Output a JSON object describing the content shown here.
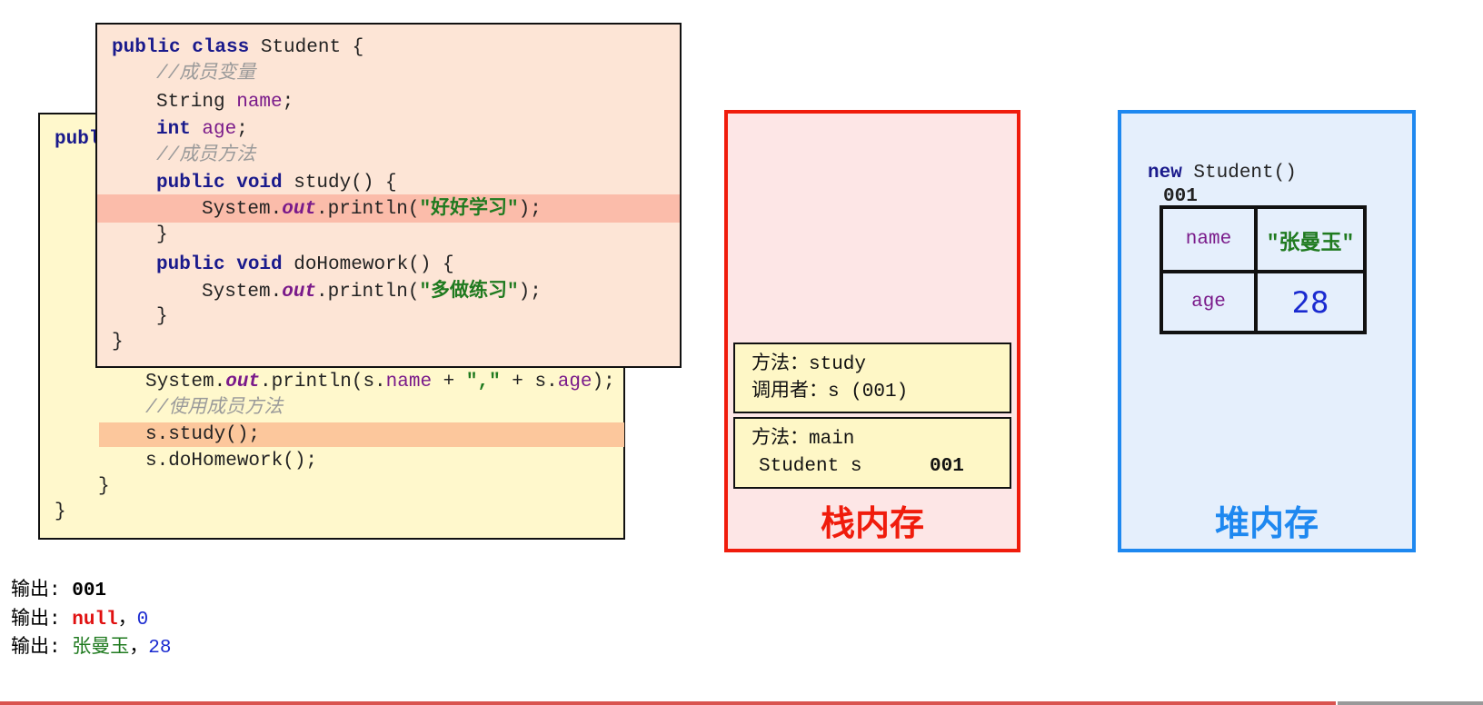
{
  "back_code": {
    "line_partial": "publ",
    "println_prefix": "System.",
    "out": "out",
    "println_mid": ".println(s.",
    "name": "name",
    "plus1": " + ",
    "comma_str": "\",\"",
    "plus2": " + s.",
    "age": "age",
    "end": ");",
    "comment": "//使用成员方法",
    "study_call": "s.study();",
    "homework_call": "s.doHomework();",
    "close_inner": "}",
    "close_outer": "}"
  },
  "front_code": {
    "kw_public_class": "public class",
    "class_name": " Student {",
    "comment_fields": "//成员变量",
    "string_type": "String ",
    "field_name": "name",
    "semi": ";",
    "int_type": "int",
    "field_age": "age",
    "comment_methods": "//成员方法",
    "kw_public_void": "public void",
    "study_sig": " study() {",
    "sys": "System.",
    "out": "out",
    "println": ".println(",
    "study_str": "\"好好学习\"",
    "end": ");",
    "close": "}",
    "homework_sig": " doHomework() {",
    "homework_str": "\"多做练习\""
  },
  "stack": {
    "label": "栈内存",
    "frames": [
      {
        "line1": "方法：study",
        "line2": "调用者：s (001)"
      },
      {
        "line1": "方法：main",
        "line2": "Student s",
        "addr": "001"
      }
    ]
  },
  "heap": {
    "label": "堆内存",
    "new_expr_kw": "new",
    "new_expr": " Student()",
    "addr": "001",
    "fields": [
      {
        "name": "name",
        "value": "\"张曼玉\""
      },
      {
        "name": "age",
        "value": "28"
      }
    ]
  },
  "output": [
    {
      "prefix": "输出: ",
      "v1": "001"
    },
    {
      "prefix": "输出: ",
      "v1": "null",
      "sep": "，",
      "v2": "0"
    },
    {
      "prefix": "输出: ",
      "v1": "张曼玉",
      "sep": "，",
      "v2": "28"
    }
  ],
  "colors": {
    "stack_border": "#f01c0c",
    "heap_border": "#1e88f0",
    "highlight": "#fbbcaa"
  }
}
